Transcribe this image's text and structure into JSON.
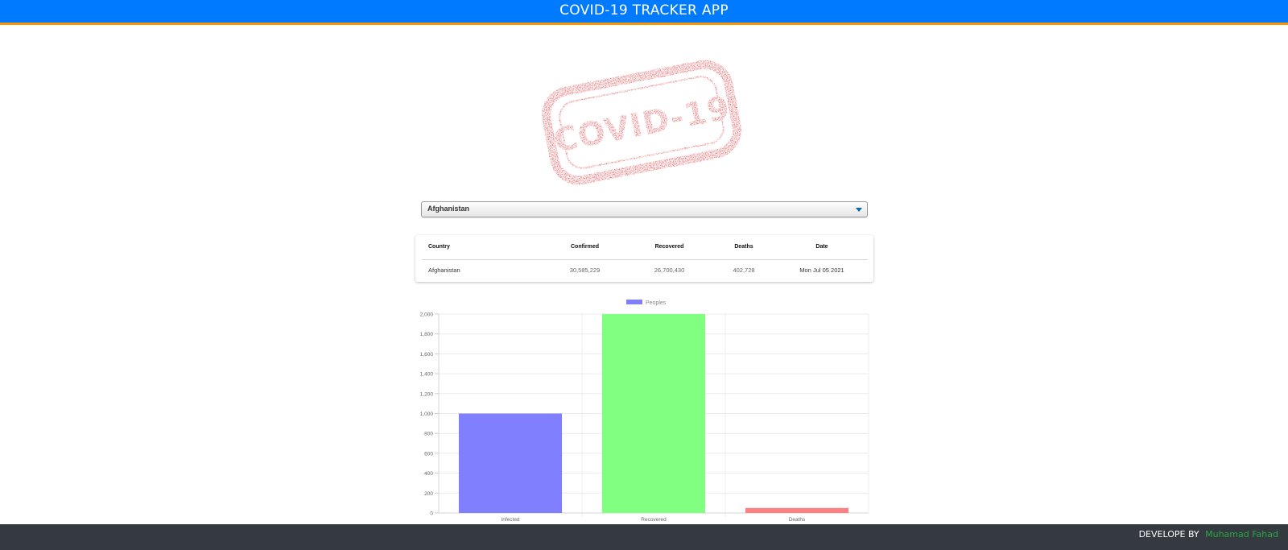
{
  "header": {
    "title": "COVID-19 TRACKER APP"
  },
  "logo": {
    "text": "COVID-19",
    "color": "#d0181e"
  },
  "country_select": {
    "selected": "Afghanistan"
  },
  "table": {
    "columns": [
      "Country",
      "Confirmed",
      "Recovered",
      "Deaths",
      "Date"
    ],
    "rows": [
      {
        "country": "Afghanistan",
        "confirmed": "30,585,229",
        "recovered": "26,700,430",
        "deaths": "402,728",
        "date": "Mon Jul 05 2021"
      }
    ]
  },
  "chart_data": {
    "type": "bar",
    "legend": "Peoples",
    "categories": [
      "Infected",
      "Recovered",
      "Deaths"
    ],
    "values": [
      1000,
      2000,
      50
    ],
    "colors": [
      "#8080ff",
      "#80ff80",
      "#ff8080"
    ],
    "ylim": [
      0,
      2000
    ],
    "yticks": [
      0,
      200,
      400,
      600,
      800,
      1000,
      1200,
      1400,
      1600,
      1800,
      2000
    ],
    "ytick_labels": [
      "0",
      "200",
      "400",
      "600",
      "800",
      "1,000",
      "1,200",
      "1,400",
      "1,600",
      "1,800",
      "2,000"
    ],
    "grid": true
  },
  "footer": {
    "label": "DEVELOPE BY",
    "author": "Muhamad Fahad",
    "author_color": "#28a745"
  }
}
